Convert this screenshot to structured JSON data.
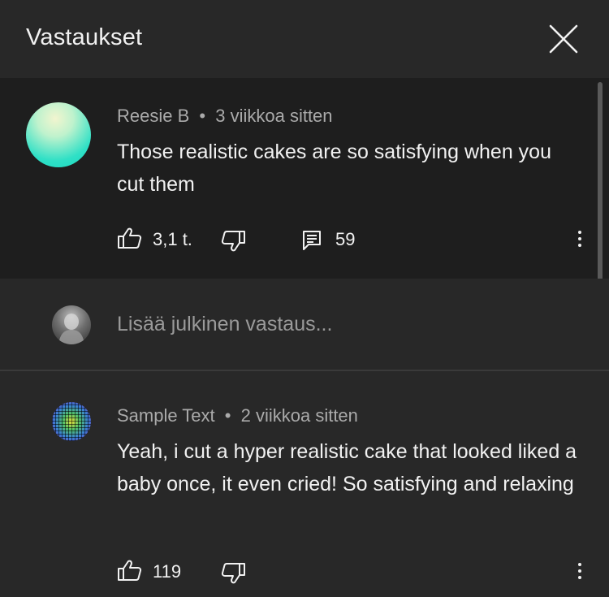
{
  "header": {
    "title": "Vastaukset",
    "close_icon": "close-icon"
  },
  "parent_comment": {
    "author": "Reesie B",
    "separator": "•",
    "time": "3 viikkoa sitten",
    "text": "Those realistic cakes are so satisfying when you cut them",
    "likes": "3,1 t.",
    "replies": "59"
  },
  "reply_box": {
    "placeholder": "Lisää julkinen vastaus..."
  },
  "replies": [
    {
      "author": "Sample Text",
      "separator": "•",
      "time": "2 viikkoa sitten",
      "text": "Yeah, i cut a hyper realistic cake that looked liked a baby once, it even cried! So satisfying and relaxing",
      "likes": "119"
    }
  ],
  "colors": {
    "background": "#282828",
    "highlighted_comment": "#1e1e1e",
    "text_primary": "#f1f1f1",
    "text_secondary": "#aaaaaa"
  }
}
